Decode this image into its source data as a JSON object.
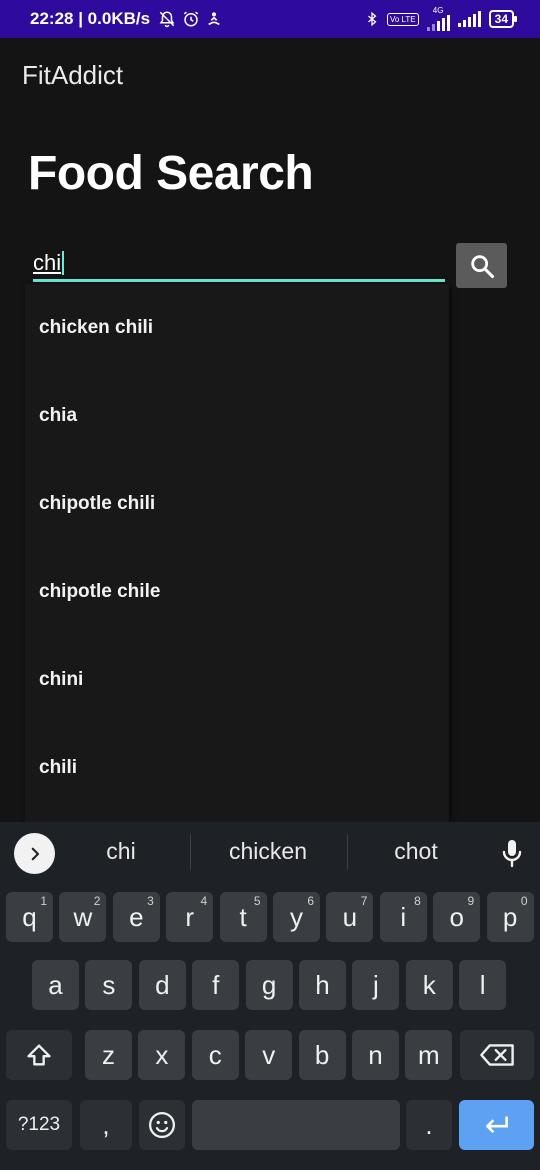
{
  "status_bar": {
    "time_speed": "22:28 | 0.0KB/s",
    "network": "4G",
    "volte": "Vo LTE",
    "battery": "34"
  },
  "app": {
    "title": "FitAddict"
  },
  "page": {
    "title": "Food Search"
  },
  "search": {
    "value": "chi"
  },
  "suggestions": [
    "chicken chili",
    "chia",
    "chipotle chili",
    "chipotle chile",
    "chini",
    "chili"
  ],
  "keyboard": {
    "suggestions": [
      "chi",
      "chicken",
      "chot"
    ],
    "row1": [
      {
        "key": "q",
        "hint": "1"
      },
      {
        "key": "w",
        "hint": "2"
      },
      {
        "key": "e",
        "hint": "3"
      },
      {
        "key": "r",
        "hint": "4"
      },
      {
        "key": "t",
        "hint": "5"
      },
      {
        "key": "y",
        "hint": "6"
      },
      {
        "key": "u",
        "hint": "7"
      },
      {
        "key": "i",
        "hint": "8"
      },
      {
        "key": "o",
        "hint": "9"
      },
      {
        "key": "p",
        "hint": "0"
      }
    ],
    "row2": [
      "a",
      "s",
      "d",
      "f",
      "g",
      "h",
      "j",
      "k",
      "l"
    ],
    "row3": [
      "z",
      "x",
      "c",
      "v",
      "b",
      "n",
      "m"
    ],
    "symbols_label": "?123",
    "comma": ",",
    "period": "."
  },
  "colors": {
    "status_bar": "#2f0b9d",
    "accent_underline": "#6ee7d4",
    "enter_key": "#5ca1f2",
    "background": "#141414"
  }
}
